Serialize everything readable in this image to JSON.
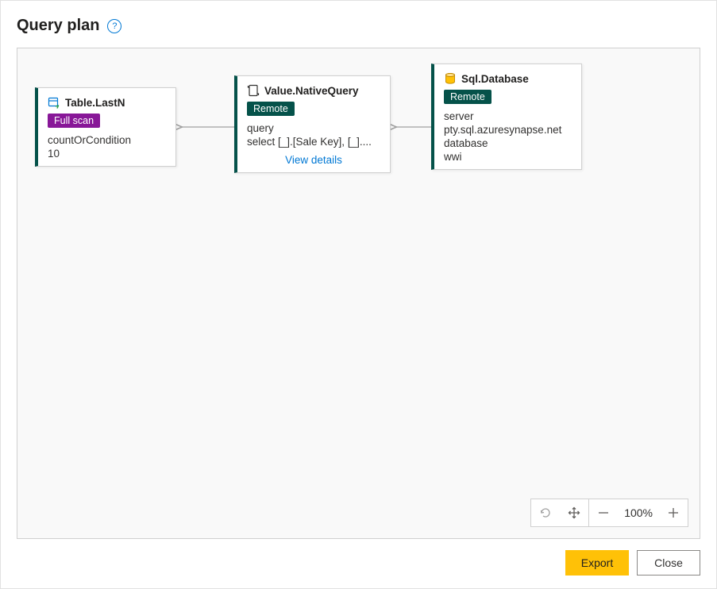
{
  "header": {
    "title": "Query plan",
    "help_glyph": "?"
  },
  "nodes": {
    "a": {
      "title": "Table.LastN",
      "badge": "Full scan",
      "field_label": "countOrCondition",
      "field_value": "10"
    },
    "b": {
      "title": "Value.NativeQuery",
      "badge": "Remote",
      "field_label": "query",
      "field_value": "select [_].[Sale Key], [_]....",
      "view_details": "View details"
    },
    "c": {
      "title": "Sql.Database",
      "badge": "Remote",
      "field1_label": "server",
      "field1_value": "pty.sql.azuresynapse.net",
      "field2_label": "database",
      "field2_value": "wwi"
    }
  },
  "zoom": {
    "level": "100%"
  },
  "footer": {
    "export_label": "Export",
    "close_label": "Close"
  }
}
